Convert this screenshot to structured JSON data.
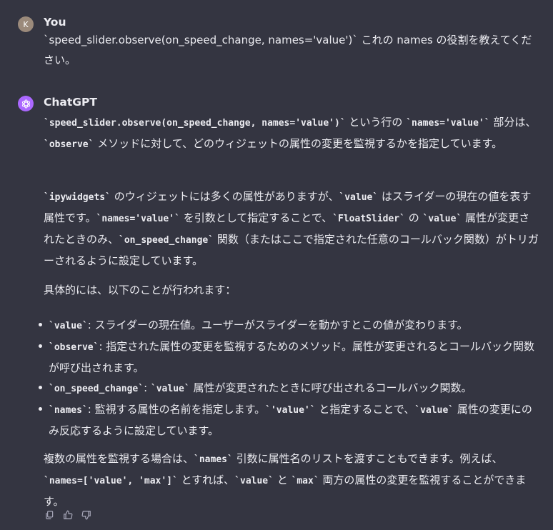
{
  "user": {
    "avatar_letter": "K",
    "name": "You",
    "message_code": "`speed_slider.observe(on_speed_change, names='value')`",
    "message_tail": " これの names の役割を教えてください。"
  },
  "assistant": {
    "name": "ChatGPT",
    "p1": {
      "c1": "`speed_slider.observe(on_speed_change, names='value')`",
      "t1": " という行の ",
      "c2": "`names='value'`",
      "t2": " 部分は、",
      "c3": "`observe`",
      "t3": " メソッドに対して、どのウィジェットの属性の変更を監視するかを指定しています。"
    },
    "p2": {
      "c1": "`ipywidgets`",
      "t1": " のウィジェットには多くの属性がありますが、",
      "c2": "`value`",
      "t2": " はスライダーの現在の値を表す属性です。",
      "c3": "`names='value'`",
      "t3": " を引数として指定することで、",
      "c4": "`FloatSlider`",
      "t4": " の ",
      "c5": "`value`",
      "t5": " 属性が変更されたときのみ、",
      "c6": "`on_speed_change`",
      "t6": " 関数（またはここで指定された任意のコールバック関数）がトリガーされるように設定しています。"
    },
    "p3": "具体的には、以下のことが行われます：",
    "bullets": [
      {
        "code": "`value`",
        "text": ": スライダーの現在値。ユーザーがスライダーを動かすとこの値が変わります。"
      },
      {
        "code": "`observe`",
        "text": ": 指定された属性の変更を監視するためのメソッド。属性が変更されるとコールバック関数が呼び出されます。"
      },
      {
        "code": "`on_speed_change`",
        "text": ": ",
        "code2": "`value`",
        "text2": " 属性が変更されたときに呼び出されるコールバック関数。"
      },
      {
        "code": "`names`",
        "text": ": 監視する属性の名前を指定します。",
        "code2": "`'value'`",
        "text2": " と指定することで、",
        "code3": "`value`",
        "text3": " 属性の変更にのみ反応するように設定しています。"
      }
    ],
    "p4": {
      "t0": "複数の属性を監視する場合は、",
      "c1": "`names`",
      "t1": " 引数に属性名のリストを渡すこともできます。例えば、",
      "c2": "`names=['value', 'max']`",
      "t2": " とすれば、",
      "c3": "`value`",
      "t3": " と ",
      "c4": "`max`",
      "t4": " 両方の属性の変更を監視することができます。"
    }
  },
  "actions": [
    "copy-icon",
    "thumbs-up-icon",
    "thumbs-down-icon"
  ]
}
